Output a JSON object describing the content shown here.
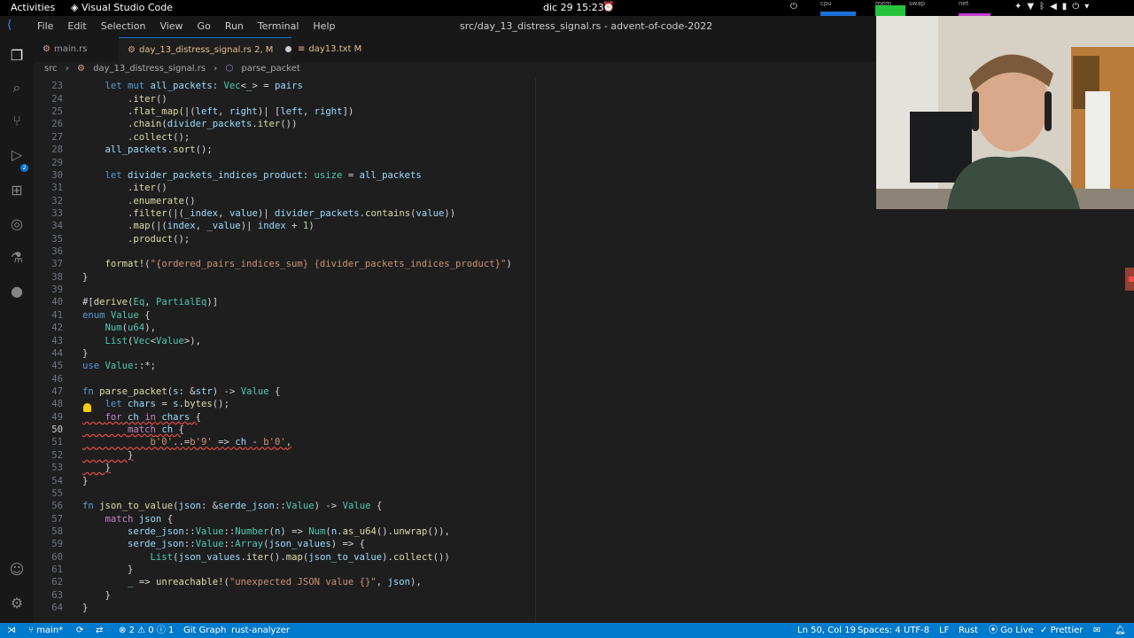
{
  "system_bar": {
    "activities": "Activities",
    "app_name": "Visual Studio Code",
    "clock": "dic 29  15:23",
    "monitors": [
      "cpu",
      "mem",
      "swap",
      "net"
    ]
  },
  "titlebar": {
    "menu": [
      "File",
      "Edit",
      "Selection",
      "View",
      "Go",
      "Run",
      "Terminal",
      "Help"
    ],
    "title": "src/day_13_distress_signal.rs - advent-of-code-2022"
  },
  "activity_bar": {
    "icons": [
      "files-icon",
      "search-icon",
      "source-control-icon",
      "run-debug-icon",
      "extensions-icon",
      "remote-explorer-icon",
      "testing-icon",
      "github-icon",
      "account-icon",
      "manage-gear-icon"
    ],
    "source_control_badge": "2"
  },
  "tabs": [
    {
      "label": "main.rs",
      "status": ""
    },
    {
      "label": "day_13_distress_signal.rs",
      "status": "2, M"
    },
    {
      "label": "day13.txt",
      "status": "M"
    }
  ],
  "breadcrumb": {
    "folder": "src",
    "file": "day_13_distress_signal.rs",
    "symbol": "parse_packet"
  },
  "editor": {
    "first_line": 22,
    "current_line": 50,
    "lines": [
      "",
      "    let mut all_packets: Vec<_> = pairs",
      "        .iter()",
      "        .flat_map(|(left, right)| [left, right])",
      "        .chain(divider_packets.iter())",
      "        .collect();",
      "    all_packets.sort();",
      "",
      "    let divider_packets_indices_product: usize = all_packets",
      "        .iter()",
      "        .enumerate()",
      "        .filter(|(_index, value)| divider_packets.contains(value))",
      "        .map(|(index, _value)| index + 1)",
      "        .product();",
      "",
      "    format!(\"{ordered_pairs_indices_sum} {divider_packets_indices_product}\")",
      "}",
      "",
      "#[derive(Eq, PartialEq)]",
      "enum Value {",
      "    Num(u64),",
      "    List(Vec<Value>),",
      "}",
      "use Value::*;",
      "",
      "fn parse_packet(s: &str) -> Value {",
      "    let chars = s.bytes();",
      "    for ch in chars {",
      "        match ch {",
      "            b'0'..=b'9' => ch - b'0',",
      "        }",
      "    }",
      "}",
      "",
      "fn json_to_value(json: &serde_json::Value) -> Value {",
      "    match json {",
      "        serde_json::Value::Number(n) => Num(n.as_u64().unwrap()),",
      "        serde_json::Value::Array(json_values) => {",
      "            List(json_values.iter().map(json_to_value).collect())",
      "        }",
      "        _ => unreachable!(\"unexpected JSON value {}\", json),",
      "    }",
      "}"
    ]
  },
  "statusbar": {
    "branch": "main*",
    "errors": "2",
    "warnings": "0",
    "info": "1",
    "git_graph": "Git Graph",
    "rust_analyzer": "rust-analyzer",
    "position": "Ln 50, Col 19",
    "spaces": "Spaces: 4",
    "encoding": "UTF-8",
    "eol": "LF",
    "language": "Rust",
    "go_live": "Go Live",
    "prettier": "Prettier"
  },
  "colors": {
    "statusbar": "#007acc",
    "editor_bg": "#1e1e1e",
    "modified_tab": "#e2c08d",
    "error": "#f14c4c"
  }
}
